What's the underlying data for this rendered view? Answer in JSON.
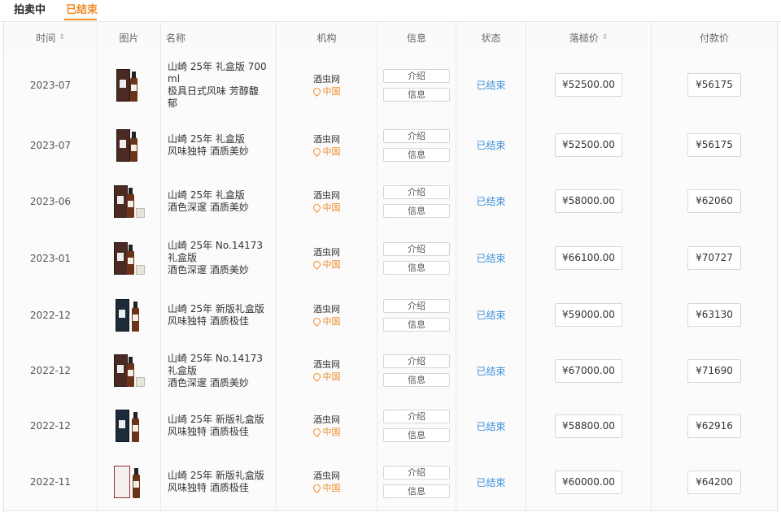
{
  "tabs": {
    "items": [
      "拍卖中",
      "已结束"
    ],
    "active_index": 1
  },
  "table": {
    "headers": {
      "time": "时间",
      "image": "图片",
      "name": "名称",
      "org": "机构",
      "info": "信息",
      "status": "状态",
      "hammer": "落槌价",
      "pay": "付款价"
    },
    "rows": [
      {
        "time": "2023-07",
        "name": "山崎 25年 礼盒版 700\nml\n极具日式风味 芳醇馥\n郁",
        "org": "酒虫网",
        "loc": "中国",
        "btn_intro": "介绍",
        "btn_info": "信息",
        "status": "已结束",
        "hammer": "¥52500.00",
        "pay": "¥56175",
        "thumb": "box"
      },
      {
        "time": "2023-07",
        "name": "山崎 25年 礼盒版\n风味独特 酒质美妙",
        "org": "酒虫网",
        "loc": "中国",
        "btn_intro": "介绍",
        "btn_info": "信息",
        "status": "已结束",
        "hammer": "¥52500.00",
        "pay": "¥56175",
        "thumb": "box"
      },
      {
        "time": "2023-06",
        "name": "山崎 25年 礼盒版\n酒色深邃 酒质美妙",
        "org": "酒虫网",
        "loc": "中国",
        "btn_intro": "介绍",
        "btn_info": "信息",
        "status": "已结束",
        "hammer": "¥58000.00",
        "pay": "¥62060",
        "thumb": "box-cup"
      },
      {
        "time": "2023-01",
        "name": "山崎 25年 No.14173\n礼盒版\n酒色深邃 酒质美妙",
        "org": "酒虫网",
        "loc": "中国",
        "btn_intro": "介绍",
        "btn_info": "信息",
        "status": "已结束",
        "hammer": "¥66100.00",
        "pay": "¥70727",
        "thumb": "box-cup"
      },
      {
        "time": "2022-12",
        "name": "山崎 25年 新版礼盒版\n风味独特 酒质极佳",
        "org": "酒虫网",
        "loc": "中国",
        "btn_intro": "介绍",
        "btn_info": "信息",
        "status": "已结束",
        "hammer": "¥59000.00",
        "pay": "¥63130",
        "thumb": "dark"
      },
      {
        "time": "2022-12",
        "name": "山崎 25年 No.14173\n礼盒版\n酒色深邃 酒质美妙",
        "org": "酒虫网",
        "loc": "中国",
        "btn_intro": "介绍",
        "btn_info": "信息",
        "status": "已结束",
        "hammer": "¥67000.00",
        "pay": "¥71690",
        "thumb": "box-cup"
      },
      {
        "time": "2022-12",
        "name": "山崎 25年 新版礼盒版\n风味独特 酒质极佳",
        "org": "酒虫网",
        "loc": "中国",
        "btn_intro": "介绍",
        "btn_info": "信息",
        "status": "已结束",
        "hammer": "¥58800.00",
        "pay": "¥62916",
        "thumb": "dark"
      },
      {
        "time": "2022-11",
        "name": "山崎 25年 新版礼盒版\n风味独特 酒质极佳",
        "org": "酒虫网",
        "loc": "中国",
        "btn_intro": "介绍",
        "btn_info": "信息",
        "status": "已结束",
        "hammer": "¥60000.00",
        "pay": "¥64200",
        "thumb": "frame"
      }
    ]
  },
  "colors": {
    "accent": "#f08a24",
    "status": "#3b8fdb"
  }
}
